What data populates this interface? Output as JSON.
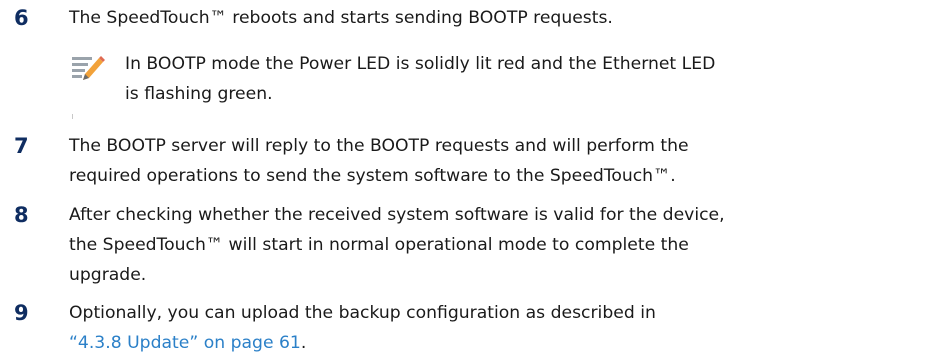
{
  "steps": [
    {
      "number": "6",
      "line1": "The SpeedTouch™ reboots and starts sending BOOTP requests."
    },
    {
      "number": "7",
      "line1": "The BOOTP server will reply to the BOOTP requests and will perform the",
      "line2": "required operations to send the system software to the SpeedTouch™."
    },
    {
      "number": "8",
      "line1": "After checking whether the received system software is valid for the device,",
      "line2": "the SpeedTouch™ will start in normal operational mode to complete the",
      "line3": "upgrade."
    },
    {
      "number": "9",
      "line1": "Optionally, you can upload the backup configuration as described in",
      "link": "“4.3.8 Update” on page 61",
      "after_link": "."
    }
  ],
  "note": {
    "icon": "note-pencil-icon",
    "line1": "In BOOTP mode the Power LED is solidly lit red and the Ethernet LED",
    "line2": "is flashing green."
  },
  "colors": {
    "step_number": "#0f2d61",
    "body_text": "#1a1a1a",
    "link": "#2b80c8",
    "icon_pencil": "#f2a23a"
  }
}
